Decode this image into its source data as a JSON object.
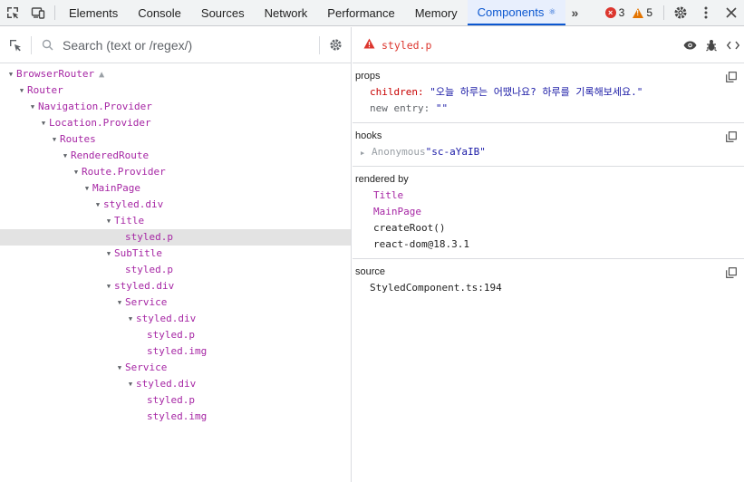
{
  "toolbar": {
    "tabs": [
      {
        "label": "Elements",
        "active": false
      },
      {
        "label": "Console",
        "active": false
      },
      {
        "label": "Sources",
        "active": false
      },
      {
        "label": "Network",
        "active": false
      },
      {
        "label": "Performance",
        "active": false
      },
      {
        "label": "Memory",
        "active": false
      },
      {
        "label": "Components",
        "active": true
      }
    ],
    "error_count": "3",
    "warning_count": "5"
  },
  "search": {
    "placeholder": "Search (text or /regex/)",
    "value": ""
  },
  "tree": [
    {
      "label": "BrowserRouter",
      "depth": 0,
      "expanded": true,
      "warning": true
    },
    {
      "label": "Router",
      "depth": 1,
      "expanded": true
    },
    {
      "label": "Navigation.Provider",
      "depth": 2,
      "expanded": true
    },
    {
      "label": "Location.Provider",
      "depth": 3,
      "expanded": true
    },
    {
      "label": "Routes",
      "depth": 4,
      "expanded": true
    },
    {
      "label": "RenderedRoute",
      "depth": 5,
      "expanded": true
    },
    {
      "label": "Route.Provider",
      "depth": 6,
      "expanded": true
    },
    {
      "label": "MainPage",
      "depth": 7,
      "expanded": true
    },
    {
      "label": "styled.div",
      "depth": 8,
      "expanded": true
    },
    {
      "label": "Title",
      "depth": 9,
      "expanded": true
    },
    {
      "label": "styled.p",
      "depth": 10,
      "selected": true
    },
    {
      "label": "SubTitle",
      "depth": 9,
      "expanded": true
    },
    {
      "label": "styled.p",
      "depth": 10
    },
    {
      "label": "styled.div",
      "depth": 9,
      "expanded": true
    },
    {
      "label": "Service",
      "depth": 10,
      "expanded": true
    },
    {
      "label": "styled.div",
      "depth": 11,
      "expanded": true
    },
    {
      "label": "styled.p",
      "depth": 12
    },
    {
      "label": "styled.img",
      "depth": 12
    },
    {
      "label": "Service",
      "depth": 10,
      "expanded": true
    },
    {
      "label": "styled.div",
      "depth": 11,
      "expanded": true
    },
    {
      "label": "styled.p",
      "depth": 12
    },
    {
      "label": "styled.img",
      "depth": 12
    }
  ],
  "inspector": {
    "component_name": "styled.p",
    "props": {
      "title": "props",
      "children_key": "children:",
      "children_value": "\"오늘 하루는 어땠나요? 하루를 기록해보세요.\"",
      "new_entry_key": "new entry:",
      "new_entry_value": "\"\""
    },
    "hooks": {
      "title": "hooks",
      "anon_label": "Anonymous",
      "anon_value": "\"sc-aYaIB\""
    },
    "rendered_by": {
      "title": "rendered by",
      "items": [
        {
          "label": "Title",
          "link": true
        },
        {
          "label": "MainPage",
          "link": true
        },
        {
          "label": "createRoot()",
          "link": false
        },
        {
          "label": "react-dom@18.3.1",
          "link": false
        }
      ]
    },
    "source": {
      "title": "source",
      "file": "StyledComponent.ts:194"
    }
  },
  "colors": {
    "accent": "#0b57d0",
    "component": "#a626a4",
    "prop_key": "#c80000",
    "string_value": "#1a1aa6",
    "error": "#dc362e",
    "warning": "#e37400",
    "selected_row": "#e3e3e3"
  }
}
